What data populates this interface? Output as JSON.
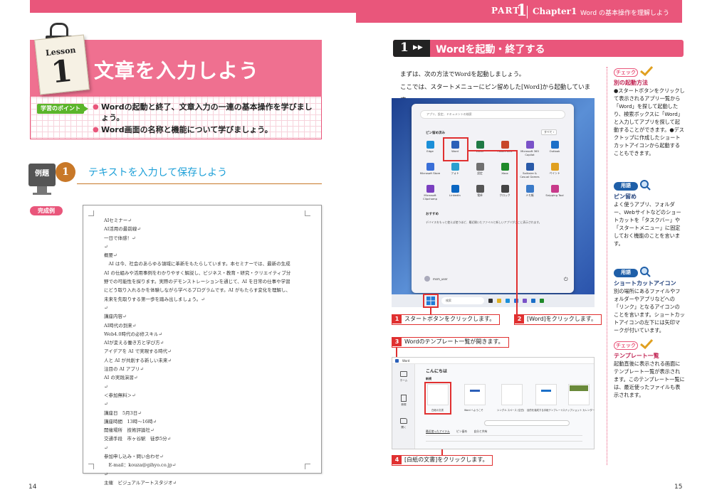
{
  "header": {
    "part_label": "PART",
    "part_number": "1",
    "chapter_label": "Chapter1",
    "chapter_title": "Word の基本操作を理解しよう"
  },
  "lesson": {
    "label": "Lesson",
    "number": "1",
    "title": "文章を入力しよう",
    "point_tag": "学習のポイント",
    "points": [
      "Wordの起動と終了、文章入力の一連の基本操作を学びましょう。",
      "Word画面の名称と機能について学びましょう。"
    ]
  },
  "example": {
    "tag": "例題",
    "number": "1",
    "title": "テキストを入力して保存しよう",
    "done_tag": "完成例",
    "doc_lines": [
      "AIセミナー↵",
      "AI活用の最前線↵",
      "一日で体感！↵",
      "↵",
      "概要↵",
      "　AI は今、社会のあらゆる領域に革新をもたらしています。本セミナーでは、最新の生成",
      "AI の仕組みや活用事例をわかりやすく解説し、ビジネス・教育・研究・クリエイティブ分",
      "野での可能性を探ります。実際のデモンストレーションを通じて、AI を日常の仕事や学習",
      "にどう取り入れるかを体験しながら学べるプログラムです。AI がもたらす変化を理解し、",
      "未来を先取りする第一歩を踏み出しましょう。↵",
      "↵",
      "講座内容↵",
      "AI時代の到来↵",
      "Web4.0時代の必修スキル↵",
      "AIが変える働き方と学び方↵",
      "アイデアを AI で実現する時代↵",
      "人と AI が共創する新しい未来↵",
      "注目の AI アプリ↵",
      "AI の実践演習↵",
      "↵",
      "＜参加無料＞↵",
      "↵",
      "講座日　5月3日↵",
      "講座時間　13時〜16時↵",
      "開催場所　技術評論社↵",
      "交通手段　市ヶ谷駅　徒歩5分↵",
      "↵",
      "参加申し込み・問い合わせ↵",
      "　E-mail：kouza@gihyo.co.jp↵",
      "↵",
      "主催　ビジュアルアートスタジオ↵"
    ]
  },
  "pages": {
    "left": "14",
    "right": "15"
  },
  "section": {
    "number": "1",
    "arrow": "▶▶",
    "title": "Wordを起動・終了する",
    "intro": [
      "まずは、次の方法でWordを起動しましょう。",
      "ここでは、スタートメニューにピン留めした[Word]から起動しています。"
    ]
  },
  "start_menu": {
    "search_placeholder": "アプリ、設定、ドキュメントの検索",
    "pinned": "ピン留め済み",
    "all_button": "すべて ›",
    "apps": [
      {
        "label": "Edge",
        "color": "#1b8fd8"
      },
      {
        "label": "Word",
        "color": "#2b5fb8"
      },
      {
        "label": "Excel",
        "color": "#1f7a45"
      },
      {
        "label": "PowerPoint",
        "color": "#c8472a"
      },
      {
        "label": "Microsoft 365 Copilot",
        "color": "#7a52c8"
      },
      {
        "label": "Outlook",
        "color": "#1b6fc8"
      },
      {
        "label": "Microsoft Store",
        "color": "#3a6fd8"
      },
      {
        "label": "フォト",
        "color": "#2a9fd0"
      },
      {
        "label": "設定",
        "color": "#707070"
      },
      {
        "label": "Xbox",
        "color": "#1f8a2a"
      },
      {
        "label": "Solitaire & Casual Games",
        "color": "#2a5aa8"
      },
      {
        "label": "ペイント",
        "color": "#e0a020"
      },
      {
        "label": "Microsoft Clipchamp",
        "color": "#7a3fc0"
      },
      {
        "label": "LinkedIn",
        "color": "#0a66c2"
      },
      {
        "label": "電卓",
        "color": "#555555"
      },
      {
        "label": "クロック",
        "color": "#444444"
      },
      {
        "label": "メモ帳",
        "color": "#3a7ac8"
      },
      {
        "label": "Snipping Tool",
        "color": "#c83a8a"
      }
    ],
    "recommended": "おすすめ",
    "recommended_text": "デバイスをもっと使えば使うほど、最近開いたファイルと新しいアプリがここに表示されます。",
    "user": "msm_user",
    "power_icon": "power-icon",
    "taskbar_search": "検索"
  },
  "callouts": {
    "c1": {
      "num": "1",
      "text": "スタートボタンをクリックします。"
    },
    "c2": {
      "num": "2",
      "text": "[Word]をクリックします。"
    },
    "c3": {
      "num": "3",
      "text": "Wordのテンプレート一覧が開きます。"
    },
    "c4": {
      "num": "4",
      "text": "[白紙の文書]をクリックします。"
    }
  },
  "word_start": {
    "app_name": "Word",
    "greeting": "こんにちは",
    "new_label": "新規",
    "side_items": [
      "ホーム",
      "新規",
      "開く"
    ],
    "templates": [
      "白紙の文書",
      "Word へようこそ",
      "シングル スペース (空白)",
      "目的を達成する手紙テンプレート",
      "スナップショット カレンダー"
    ],
    "tabs": [
      "最近使ったアイテム",
      "ピン留め",
      "自分と共有"
    ]
  },
  "notes": [
    {
      "tag": "チェック",
      "kind": "check",
      "title": "別の起動方法",
      "body": "●スタートボタンをクリックして表示されるアプリ一覧から「Word」を探して起動したり、検索ボックスに「Word」と入力してアプリを探して起動することができます。●デスクトップに作成したショートカットアイコンから起動することもできます。"
    },
    {
      "tag": "用語",
      "kind": "term",
      "title": "ピン留め",
      "body": "よく使うアプリ、フォルダー、Webサイトなどのショートカットを「タスクバー」や「スタートメニュー」に固定しておく機能のことを言います。"
    },
    {
      "tag": "用語",
      "kind": "term",
      "title": "ショートカットアイコン",
      "body": "別の場所にあるファイルやフォルダーやアプリなどへの「リンク」となるアイコンのことを言います。ショートカットアイコンの左下には矢印マークが付いています。"
    },
    {
      "tag": "チェック",
      "kind": "check",
      "title": "テンプレート一覧",
      "body": "起動直後に表示される画面にテンプレート一覧が表示されます。このテンプレート一覧には、最近使ったファイルも表示されます。"
    }
  ],
  "colors": {
    "accent": "#e9567b",
    "green": "#5bb52a",
    "orange": "#c87828",
    "blue": "#1ea0d8",
    "red": "#e03030"
  }
}
